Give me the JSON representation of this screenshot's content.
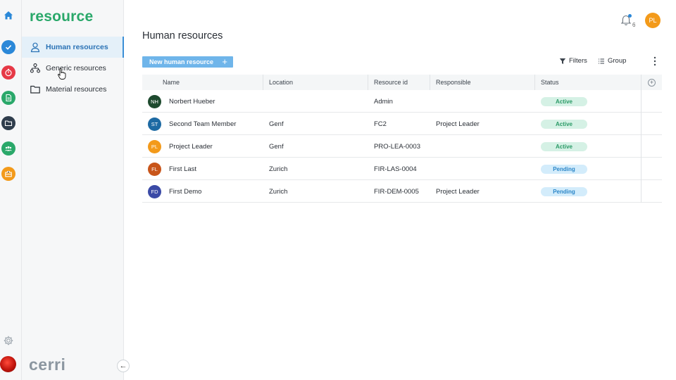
{
  "colors": {
    "brand": "#2aa86a",
    "primary_button": "#6fb5ea",
    "active_nav": "#2a72b5",
    "badge_active": "#2a9a66",
    "badge_pending": "#2b86c8"
  },
  "rail": {
    "apps": [
      {
        "name": "home-icon",
        "color": "#2b88d8"
      },
      {
        "name": "check-icon",
        "color": "#2b88d8"
      },
      {
        "name": "stopwatch-icon",
        "color": "#e63946"
      },
      {
        "name": "document-icon",
        "color": "#2aa86a"
      },
      {
        "name": "folder-icon",
        "color": "#2f3d4c"
      },
      {
        "name": "people-icon",
        "color": "#2aa86a"
      },
      {
        "name": "briefcase-icon",
        "color": "#f39a1a"
      },
      {
        "name": "gear-icon",
        "color": "#9aa3ab"
      }
    ]
  },
  "sidebar": {
    "brand": "resource",
    "items": [
      {
        "label": "Human resources",
        "icon": "person-icon",
        "active": true
      },
      {
        "label": "Generic resources",
        "icon": "hierarchy-icon",
        "active": false
      },
      {
        "label": "Material resources",
        "icon": "folder-icon",
        "active": false
      }
    ],
    "footer_logo": "cerri",
    "collapse_glyph": "←"
  },
  "header": {
    "title": "Human resources",
    "notification_count": "6",
    "user_initials": "PL",
    "user_color": "#f39a1a"
  },
  "toolbar": {
    "new_label": "New human resource",
    "new_plus": "+",
    "filters_label": "Filters",
    "group_label": "Group"
  },
  "table": {
    "columns": [
      "Name",
      "Location",
      "Resource id",
      "Responsible",
      "Status"
    ],
    "add_column_glyph": "+",
    "rows": [
      {
        "initials": "NH",
        "avatar_color": "#1e4a2e",
        "name": "Norbert Hueber",
        "location": "",
        "resource_id": "Admin",
        "responsible": "",
        "status": "Active",
        "status_type": "active"
      },
      {
        "initials": "ST",
        "avatar_color": "#1d6aa3",
        "name": "Second Team Member",
        "location": "Genf",
        "resource_id": "FC2",
        "responsible": "Project Leader",
        "status": "Active",
        "status_type": "active"
      },
      {
        "initials": "PL",
        "avatar_color": "#f39a1a",
        "name": "Project Leader",
        "location": "Genf",
        "resource_id": "PRO-LEA-0003",
        "responsible": "",
        "status": "Active",
        "status_type": "active"
      },
      {
        "initials": "FL",
        "avatar_color": "#c8551a",
        "name": "First Last",
        "location": "Zurich",
        "resource_id": "FIR-LAS-0004",
        "responsible": "",
        "status": "Pending",
        "status_type": "pending"
      },
      {
        "initials": "FD",
        "avatar_color": "#3b4aa6",
        "name": "First Demo",
        "location": "Zurich",
        "resource_id": "FIR-DEM-0005",
        "responsible": "Project Leader",
        "status": "Pending",
        "status_type": "pending"
      }
    ]
  }
}
